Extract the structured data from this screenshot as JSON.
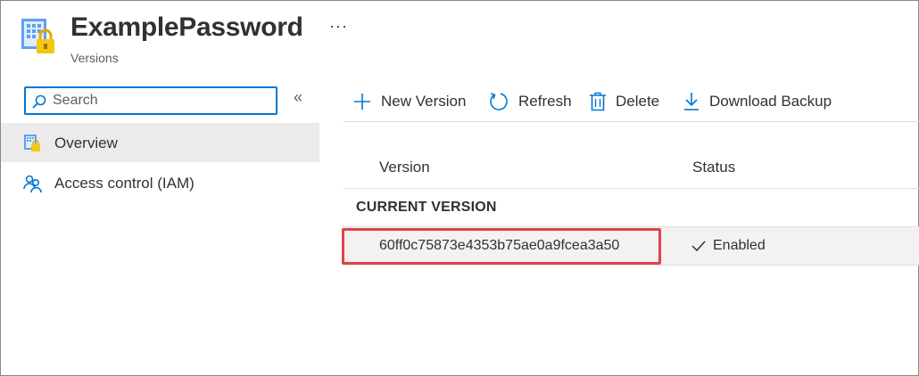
{
  "header": {
    "title": "ExamplePassword",
    "subtitle": "Versions",
    "more_label": "···",
    "icon": "key-vault-secret-icon"
  },
  "sidebar": {
    "search_placeholder": "Search",
    "collapse_label": "«",
    "items": [
      {
        "label": "Overview",
        "icon": "secret-overview-icon",
        "active": true
      },
      {
        "label": "Access control (IAM)",
        "icon": "people-icon",
        "active": false
      }
    ]
  },
  "toolbar": {
    "new_version": "New Version",
    "refresh": "Refresh",
    "delete": "Delete",
    "download_backup": "Download Backup"
  },
  "table": {
    "columns": [
      "Version",
      "Status"
    ],
    "group_label": "CURRENT VERSION",
    "rows": [
      {
        "version": "60ff0c75873e4353b75ae0a9fcea3a50",
        "status": "Enabled",
        "highlighted": true
      }
    ]
  },
  "colors": {
    "accent": "#0078d4",
    "highlight": "#e0434b",
    "row_bg": "#f3f2f1",
    "active_nav": "#edebe9"
  }
}
